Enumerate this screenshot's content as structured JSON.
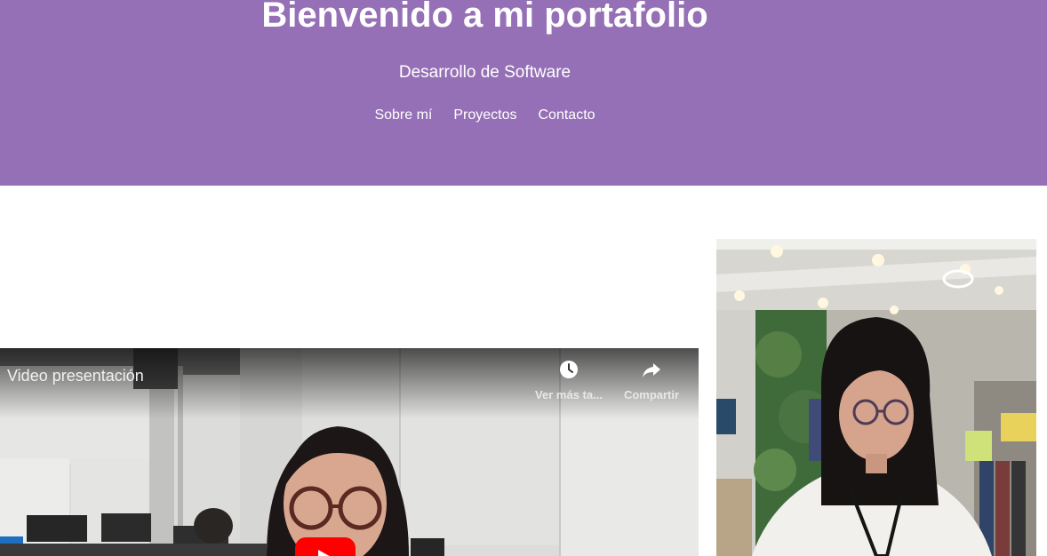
{
  "header": {
    "title": "Bienvenido a mi portafolio",
    "subtitle": "Desarrollo de Software",
    "nav": [
      "Sobre mí",
      "Proyectos",
      "Contacto"
    ],
    "background_color": "#9670b6"
  },
  "video": {
    "title": "Video presentación",
    "watch_later_label": "Ver más ta...",
    "share_label": "Compartir",
    "watch_later_icon": "clock-icon",
    "share_icon": "share-arrow-icon",
    "play_icon": "youtube-play-icon",
    "play_color": "#ff0000"
  },
  "profile_photo": {
    "subject": "portrait of a young woman with glasses in a clothing store"
  }
}
